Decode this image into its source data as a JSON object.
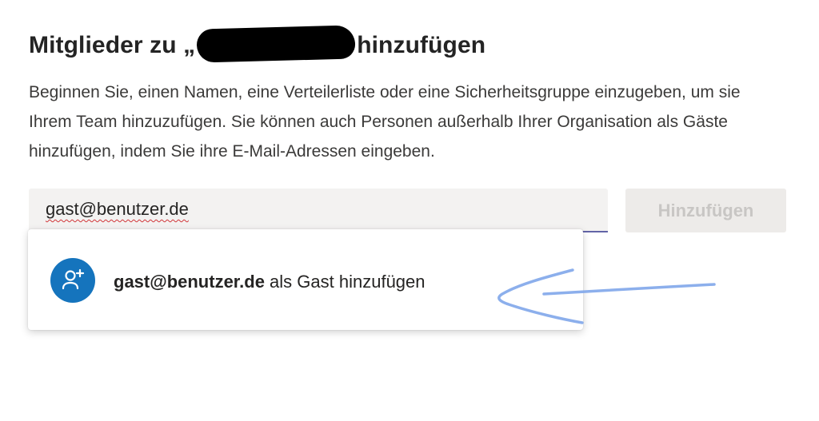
{
  "dialog": {
    "title_prefix": "Mitglieder zu „",
    "title_suffix": "hinzufügen",
    "description": "Beginnen Sie, einen Namen, eine Verteilerliste oder eine Sicherheitsgruppe einzugeben, um sie Ihrem Team hinzuzufügen. Sie können auch Personen außerhalb Ihrer Organisation als Gäste hinzufügen, indem Sie ihre E-Mail-Adressen eingeben.",
    "input_value": "gast@benutzer.de",
    "add_button_label": "Hinzufügen"
  },
  "suggestion": {
    "email": "gast@benutzer.de",
    "action_text": " als Gast hinzufügen",
    "icon": "add-guest-icon"
  },
  "colors": {
    "accent": "#6264a7",
    "avatar": "#1574bd",
    "annotation_arrow": "#7fa6ea",
    "disabled_button_bg": "#edebe9",
    "disabled_button_text": "#c8c6c4"
  }
}
